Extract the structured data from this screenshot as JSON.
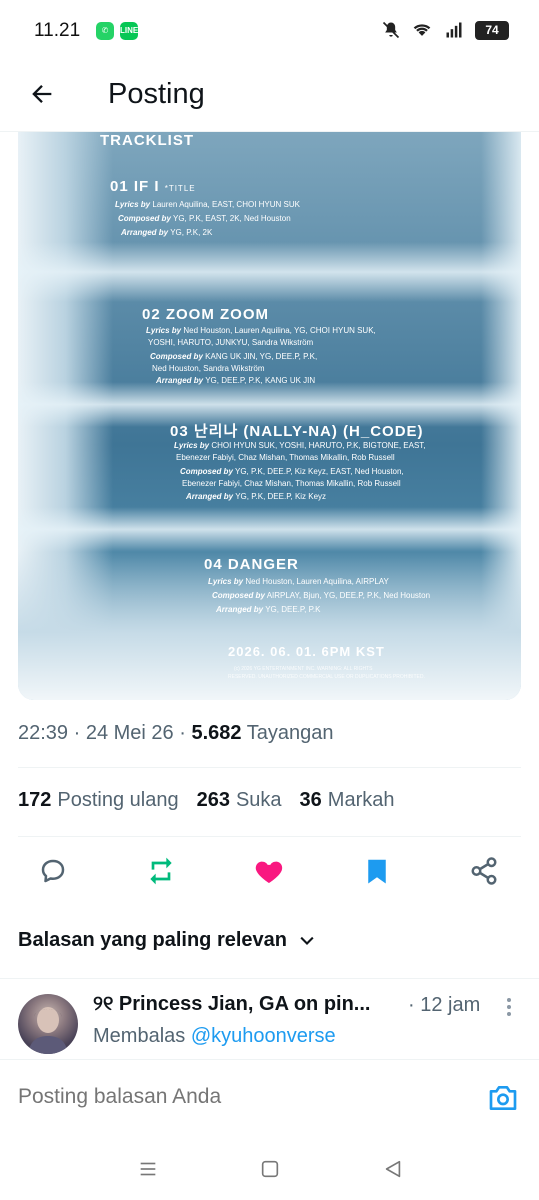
{
  "status_bar": {
    "time": "11.21",
    "battery": "74",
    "app_badges": [
      "whatsapp-icon",
      "line-icon"
    ],
    "icons": [
      "mute-icon",
      "wifi-icon",
      "signal-icon"
    ]
  },
  "header": {
    "title": "Posting"
  },
  "image": {
    "heading": "TRACKLIST",
    "tracks": [
      {
        "title": "01 IF I",
        "tag": "*TITLE",
        "lines": [
          {
            "label": "Lyrics by",
            "text": "Lauren Aquilina, EAST, CHOI HYUN SUK"
          },
          {
            "label": "Composed by",
            "text": "YG, P.K, EAST, 2K, Ned Houston"
          },
          {
            "label": "Arranged by",
            "text": "YG, P.K, 2K"
          }
        ]
      },
      {
        "title": "02 ZOOM ZOOM",
        "lines": [
          {
            "label": "Lyrics by",
            "text": "Ned Houston, Lauren Aquilina, YG, CHOI HYUN SUK,"
          },
          {
            "label": "",
            "text": "YOSHI, HARUTO, JUNKYU, Sandra Wikström"
          },
          {
            "label": "Composed by",
            "text": "KANG UK JIN, YG, DEE.P, P.K,"
          },
          {
            "label": "",
            "text": "Ned Houston, Sandra Wikström"
          },
          {
            "label": "Arranged by",
            "text": "YG, DEE.P, P.K, KANG UK JIN"
          }
        ]
      },
      {
        "title": "03 난리나 (NALLY-NA) (H_CODE)",
        "lines": [
          {
            "label": "Lyrics by",
            "text": "CHOI HYUN SUK, YOSHI, HARUTO, P.K, BIGTONE, EAST,"
          },
          {
            "label": "",
            "text": "Ebenezer Fabiyi, Chaz Mishan, Thomas Mikallin, Rob Russell"
          },
          {
            "label": "Composed by",
            "text": "YG, P.K, DEE.P, Kiz Keyz, EAST, Ned Houston,"
          },
          {
            "label": "",
            "text": "Ebenezer Fabiyi, Chaz Mishan, Thomas Mikallin, Rob Russell"
          },
          {
            "label": "Arranged by",
            "text": "YG, P.K, DEE.P, Kiz Keyz"
          }
        ]
      },
      {
        "title": "04 DANGER",
        "lines": [
          {
            "label": "Lyrics by",
            "text": "Ned Houston, Lauren Aquilina, AIRPLAY"
          },
          {
            "label": "Composed by",
            "text": "AIRPLAY, Bjun, YG, DEE.P, P.K, Ned Houston"
          },
          {
            "label": "Arranged by",
            "text": "YG, DEE.P, P.K"
          }
        ]
      }
    ],
    "release": "2026. 06. 01. 6PM KST",
    "fine_print_1": "(c) 2026 YG ENTERTAINMENT INC. WARNING: ALL RIGHTS",
    "fine_print_2": "RESERVED. UNAUTHORIZED COMMERCIAL USE OR DUPLICATIONS PROHIBITED."
  },
  "meta": {
    "time": "22:39",
    "date": "24 Mei 26",
    "views": "5.682",
    "views_label": "Tayangan"
  },
  "stats": {
    "reposts": "172",
    "reposts_label": "Posting ulang",
    "likes": "263",
    "likes_label": "Suka",
    "bookmarks": "36",
    "bookmarks_label": "Markah"
  },
  "actions": {
    "colors": {
      "reply": "#536471",
      "repost": "#00ba7c",
      "like": "#f91880",
      "bookmark": "#1d9bf0",
      "share": "#536471"
    }
  },
  "relevance": {
    "label": "Balasan yang paling relevan"
  },
  "reply": {
    "name": "୨୧ Princess Jian, GA on pin...",
    "time": "· 12 jam",
    "replying_prefix": "Membalas",
    "handle": "@kyuhoonverse"
  },
  "compose": {
    "placeholder": "Posting balasan Anda"
  },
  "accent_color": "#1d9bf0"
}
